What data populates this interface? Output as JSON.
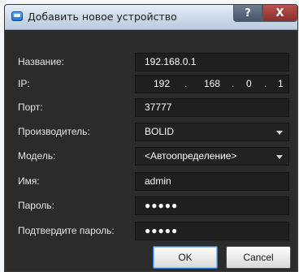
{
  "window": {
    "title": "Добавить новое устройство",
    "help_label": "?",
    "close_label": "X"
  },
  "form": {
    "name_label": "Название:",
    "name_value": "192.168.0.1",
    "ip_label": "IP:",
    "ip_octets": [
      "192",
      "168",
      "0",
      "1"
    ],
    "ip_separator": ".",
    "port_label": "Порт:",
    "port_value": "37777",
    "manufacturer_label": "Производитель:",
    "manufacturer_value": "BOLID",
    "model_label": "Модель:",
    "model_value": "<Автоопределение>",
    "username_label": "Имя:",
    "username_value": "admin",
    "password_label": "Пароль:",
    "password_value": "●●●●●",
    "confirm_password_label": "Подтвердите пароль:",
    "confirm_password_value": "●●●●●"
  },
  "buttons": {
    "ok_label": "OK",
    "cancel_label": "Cancel"
  }
}
